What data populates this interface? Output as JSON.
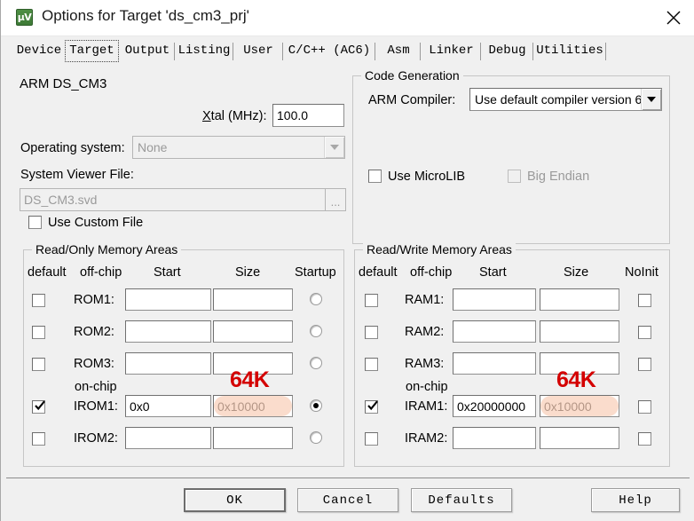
{
  "window": {
    "title": "Options for Target 'ds_cm3_prj'",
    "icon": "keil-uvision-icon",
    "icon_text": "µV",
    "close_icon": "close-icon"
  },
  "tabs": [
    {
      "label": "Device",
      "active": false
    },
    {
      "label": "Target",
      "active": true
    },
    {
      "label": "Output",
      "active": false
    },
    {
      "label": "Listing",
      "active": false
    },
    {
      "label": "User",
      "active": false
    },
    {
      "label": "C/C++ (AC6)",
      "active": false
    },
    {
      "label": "Asm",
      "active": false
    },
    {
      "label": "Linker",
      "active": false
    },
    {
      "label": "Debug",
      "active": false
    },
    {
      "label": "Utilities",
      "active": false
    }
  ],
  "target": {
    "device_name": "ARM DS_CM3",
    "xtal_label": "Xtal (MHz):",
    "xtal_value": "100.0",
    "os_label": "Operating system:",
    "os_value": "None",
    "svf_label": "System Viewer File:",
    "svf_value": "DS_CM3.svd",
    "browse_label": "...",
    "custom_file_label": "Use Custom File",
    "custom_file_checked": false
  },
  "code_generation": {
    "title": "Code Generation",
    "compiler_label": "ARM Compiler:",
    "compiler_value": "Use default compiler version 6",
    "microlib_label": "Use MicroLIB",
    "microlib_checked": false,
    "big_endian_label": "Big Endian",
    "big_endian_checked": false,
    "big_endian_disabled": true
  },
  "rom_panel": {
    "title": "Read/Only Memory Areas",
    "headers": [
      "default",
      "off-chip",
      "Start",
      "Size",
      "Startup"
    ],
    "onchip_label": "on-chip",
    "rows": [
      {
        "name": "ROM1:",
        "checked": false,
        "start": "",
        "size": "",
        "startup": false
      },
      {
        "name": "ROM2:",
        "checked": false,
        "start": "",
        "size": "",
        "startup": false
      },
      {
        "name": "ROM3:",
        "checked": false,
        "start": "",
        "size": "",
        "startup": false
      },
      {
        "name": "IROM1:",
        "checked": true,
        "start": "0x0",
        "size": "0x10000",
        "startup": true
      },
      {
        "name": "IROM2:",
        "checked": false,
        "start": "",
        "size": "",
        "startup": false
      }
    ],
    "annotation": "64K"
  },
  "ram_panel": {
    "title": "Read/Write Memory Areas",
    "headers": [
      "default",
      "off-chip",
      "Start",
      "Size",
      "NoInit"
    ],
    "onchip_label": "on-chip",
    "rows": [
      {
        "name": "RAM1:",
        "checked": false,
        "start": "",
        "size": "",
        "noinit": false
      },
      {
        "name": "RAM2:",
        "checked": false,
        "start": "",
        "size": "",
        "noinit": false
      },
      {
        "name": "RAM3:",
        "checked": false,
        "start": "",
        "size": "",
        "noinit": false
      },
      {
        "name": "IRAM1:",
        "checked": true,
        "start": "0x20000000",
        "size": "0x10000",
        "noinit": false
      },
      {
        "name": "IRAM2:",
        "checked": false,
        "start": "",
        "size": "",
        "noinit": false
      }
    ],
    "annotation": "64K"
  },
  "footer": {
    "ok": "OK",
    "cancel": "Cancel",
    "defaults": "Defaults",
    "help": "Help"
  },
  "colors": {
    "dialog_bg": "#f0f0f0",
    "annotation_red": "#d40000",
    "annotation_highlight": "#f8cfb8",
    "icon_green": "#3d7a36"
  }
}
